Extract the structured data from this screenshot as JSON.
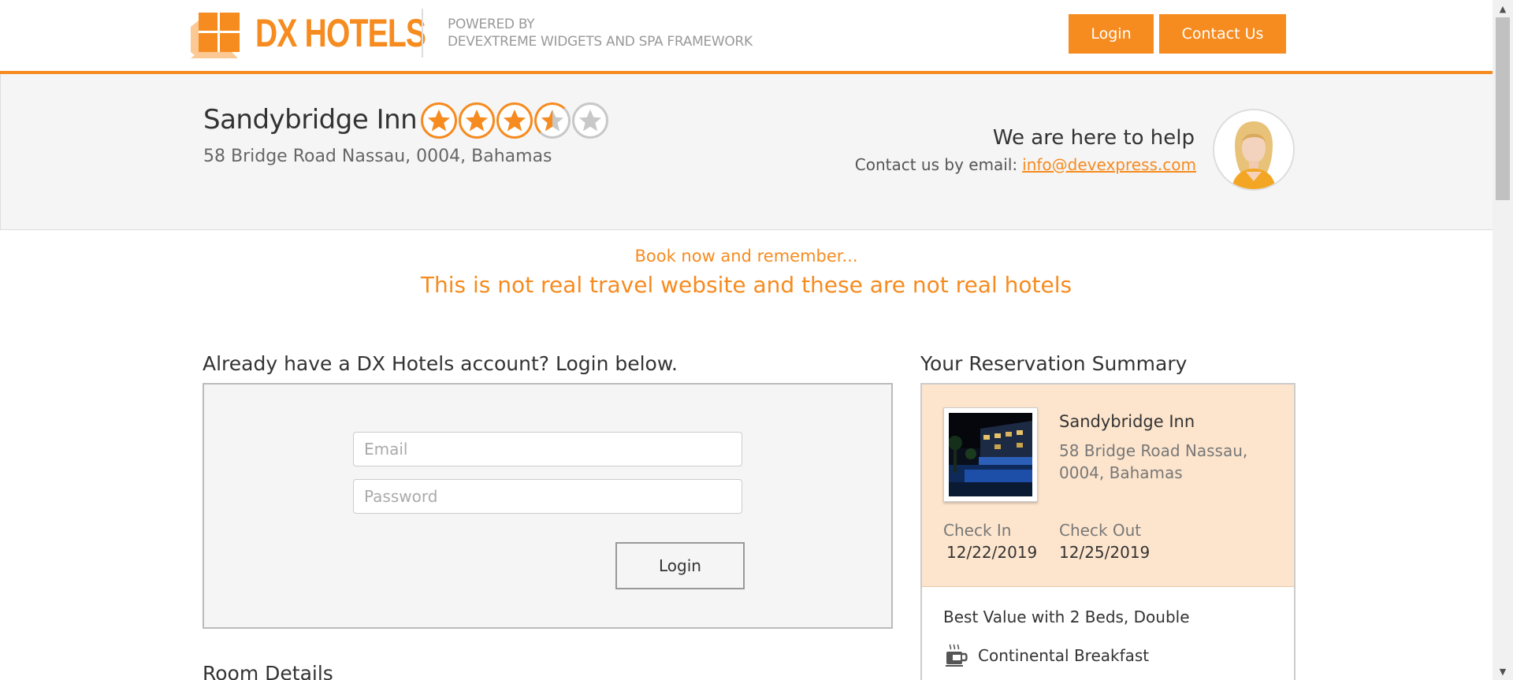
{
  "header": {
    "brand": "DX HOTELS",
    "powered_line1": "POWERED BY",
    "powered_line2": "DEVEXTREME WIDGETS AND SPA FRAMEWORK",
    "login_label": "Login",
    "contact_label": "Contact Us",
    "accent_color": "#f68b1f",
    "logo_icon": "dx-hotels-logo-icon"
  },
  "hotel": {
    "name": "Sandybridge Inn",
    "address": "58 Bridge Road Nassau, 0004, Bahamas",
    "rating": 3.5,
    "rating_max": 5
  },
  "help": {
    "title": "We are here to help",
    "contact_prefix": "Contact us by email:",
    "email": "info@devexpress.com",
    "avatar_icon": "support-agent-avatar"
  },
  "notice": {
    "line1": "Book now and remember...",
    "line2": "This is not real travel website and these are not real hotels"
  },
  "login": {
    "title": "Already have a DX Hotels account? Login below.",
    "email_placeholder": "Email",
    "password_placeholder": "Password",
    "button_label": "Login"
  },
  "room_details": {
    "title": "Room Details"
  },
  "summary": {
    "title": "Your Reservation Summary",
    "hotel_name": "Sandybridge Inn",
    "hotel_address": "58 Bridge Road Nassau, 0004, Bahamas",
    "check_in_label": "Check In",
    "check_in_value": "12/22/2019",
    "check_out_label": "Check Out",
    "check_out_value": "12/25/2019",
    "room_type": "Best Value with 2 Beds, Double",
    "amenity_label": "Continental Breakfast",
    "amenity_icon": "coffee-cup-icon",
    "background_color": "#fde5cd"
  },
  "scrollbar": {
    "up_icon": "scroll-up-arrow-icon",
    "down_icon": "scroll-down-arrow-icon"
  }
}
